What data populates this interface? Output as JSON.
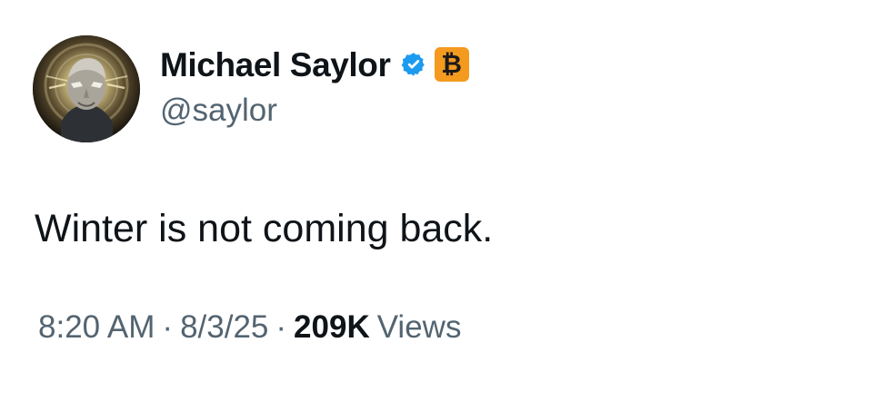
{
  "author": {
    "display_name": "Michael Saylor",
    "handle": "@saylor",
    "badge_icon": "verified-icon",
    "secondary_badge_text": "₿"
  },
  "tweet": {
    "text": "Winter is not coming back."
  },
  "meta": {
    "time": "8:20 AM",
    "separator_1": "·",
    "date": "8/3/25",
    "separator_2": "·",
    "views_count": "209K",
    "views_label": "Views"
  },
  "colors": {
    "background": "#ffffff",
    "text_primary": "#0f1419",
    "text_secondary": "#536471",
    "verified_blue": "#1d9bf0",
    "bitcoin_orange": "#f39a1f"
  }
}
